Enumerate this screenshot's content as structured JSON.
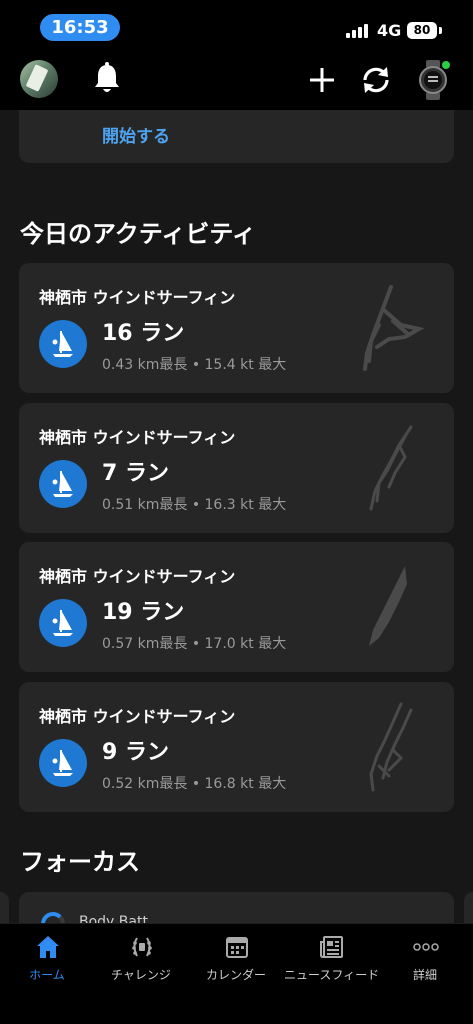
{
  "status_bar": {
    "time": "16:53",
    "network": "4G",
    "battery": "80"
  },
  "content": {
    "start_link": "開始する",
    "today_title": "今日のアクティビティ",
    "activities": [
      {
        "title": "神栖市 ウインドサーフィン",
        "runs": "16 ラン",
        "stats": "0.43 km最長 • 15.4 kt 最大"
      },
      {
        "title": "神栖市 ウインドサーフィン",
        "runs": "7 ラン",
        "stats": "0.51 km最長 • 16.3 kt 最大"
      },
      {
        "title": "神栖市 ウインドサーフィン",
        "runs": "19 ラン",
        "stats": "0.57 km最長 • 17.0 kt 最大"
      },
      {
        "title": "神栖市 ウインドサーフィン",
        "runs": "9 ラン",
        "stats": "0.52 km最長 • 16.8 kt 最大"
      }
    ],
    "focus_title": "フォーカス",
    "focus_peek": "Body Batt"
  },
  "tabs": [
    {
      "label": "ホーム",
      "icon": "home-icon",
      "active": true
    },
    {
      "label": "チャレンジ",
      "icon": "laurel-icon",
      "active": false
    },
    {
      "label": "カレンダー",
      "icon": "calendar-icon",
      "active": false
    },
    {
      "label": "ニュースフィード",
      "icon": "newsfeed-icon",
      "active": false
    },
    {
      "label": "詳細",
      "icon": "more-icon",
      "active": false
    }
  ],
  "colors": {
    "accent": "#2f8cf0",
    "card": "#262626",
    "background": "#171717",
    "activity_icon": "#1f78d1",
    "watch_status": "#2ecc40"
  }
}
